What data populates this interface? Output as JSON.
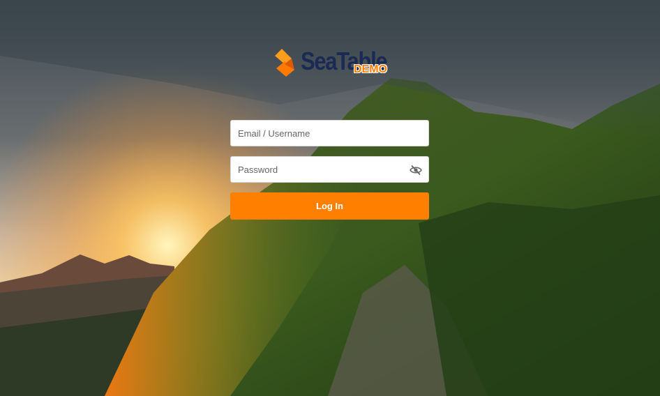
{
  "brand": {
    "name": "SeaTable",
    "edition": "DEMO",
    "colors": {
      "primary": "#ff8000",
      "text": "#1a2a55"
    }
  },
  "login_form": {
    "username_placeholder": "Email / Username",
    "password_placeholder": "Password",
    "password_toggle_icon": "eye-slash-icon",
    "submit_label": "Log In"
  }
}
